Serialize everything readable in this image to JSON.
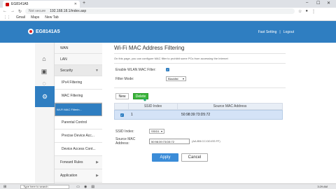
{
  "browser": {
    "tab_title": "EG8141A5",
    "new_tab": "+",
    "url_status": "Not secure",
    "url": "192.168.18.1/index.asp",
    "bookmarks": [
      "Gmail",
      "Maps",
      "New Tab"
    ]
  },
  "router": {
    "brand": "EG8141A5",
    "header_links": [
      "Fast Setting",
      "Logout"
    ],
    "header_separator": "|",
    "left_nav": [
      {
        "label": "WAN",
        "type": "item"
      },
      {
        "label": "LAN",
        "type": "item"
      },
      {
        "label": "Security",
        "type": "section"
      },
      {
        "label": "IPv4 Filtering",
        "type": "sub"
      },
      {
        "label": "MAC Filtering",
        "type": "sub"
      },
      {
        "label": "Wi-Fi MAC Filterin...",
        "type": "selected"
      },
      {
        "label": "Parental Control",
        "type": "sub"
      },
      {
        "label": "Precise Device Acc...",
        "type": "sub"
      },
      {
        "label": "Device Access Cont...",
        "type": "sub"
      },
      {
        "label": "Forward Rules",
        "type": "item"
      },
      {
        "label": "Application",
        "type": "item"
      }
    ],
    "page": {
      "title": "Wi-Fi MAC Address Filtering",
      "description": "On this page, you can configure MAC filter to prohibit some PCs from accessing the Internet",
      "enable_label": "Enable WLAN MAC Filter:",
      "enable_checked": true,
      "filter_mode_label": "Filter Mode:",
      "filter_mode_value": "Blacklist",
      "new_button": "New",
      "delete_button": "Delete",
      "table": {
        "columns": [
          "SSID Index",
          "Source MAC Address"
        ],
        "rows": [
          {
            "checked": true,
            "index": "1",
            "mac": "50:98:39:73:D5:72"
          }
        ]
      },
      "ssid_index_label": "SSID Index:",
      "ssid_index_value": "SSID1",
      "source_mac_label": "Source MAC Address:",
      "source_mac_value": "50:98:39:73:D5:72",
      "source_mac_hint": "(AA:BB:CC:DD:EE:FF)",
      "apply_button": "Apply",
      "cancel_button": "Cancel"
    }
  },
  "taskbar": {
    "search_placeholder": "Type here to search",
    "time": "3:29 AM"
  }
}
